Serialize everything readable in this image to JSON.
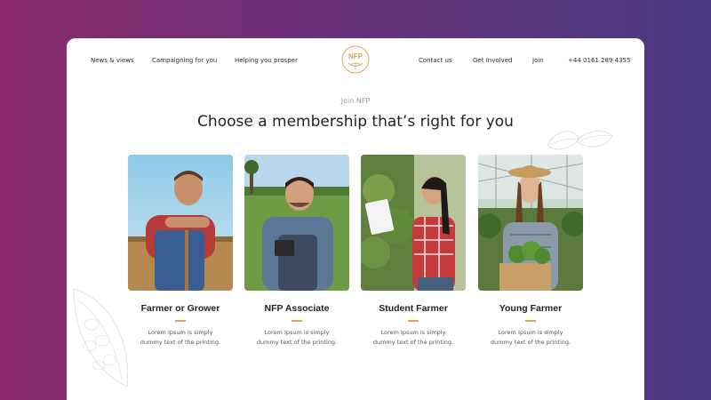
{
  "nav": {
    "left": [
      "News & views",
      "Campaigning for you",
      "Helping you prosper"
    ],
    "right": [
      "Contact us",
      "Get Involved",
      "Join",
      "+44 0161 289 4355"
    ],
    "logo_text": "NFP"
  },
  "hero": {
    "eyebrow": "Join NFP",
    "headline": "Choose a membership that’s right for you"
  },
  "memberships": [
    {
      "title": "Farmer or Grower",
      "text": "Lorem Ipsum is simply dummy text of the printing."
    },
    {
      "title": "NFP Associate",
      "text": "Lorem Ipsum is simply dummy text of the printing."
    },
    {
      "title": "Student Farmer",
      "text": "Lorem Ipsum is simply dummy text of the printing."
    },
    {
      "title": "Young Farmer",
      "text": "Lorem Ipsum is simply dummy text of the printing."
    }
  ],
  "colors": {
    "accent": "#d4a660",
    "bg_left": "#8a2a6f",
    "bg_right": "#4a3a82"
  }
}
